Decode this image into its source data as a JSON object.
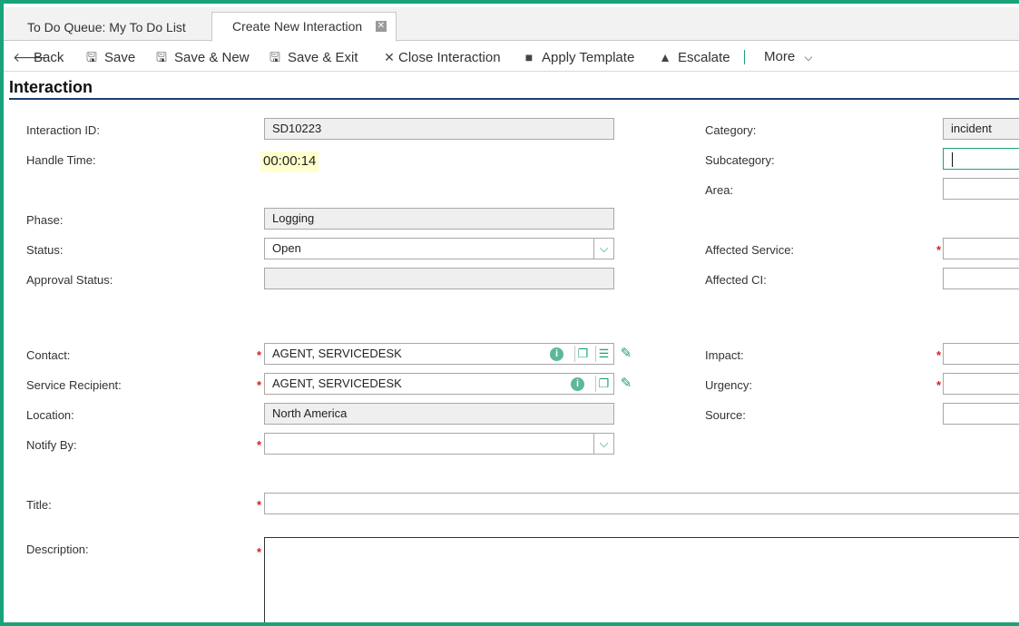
{
  "tabs": [
    {
      "label": "To Do Queue: My To Do List"
    },
    {
      "label": "Create New Interaction",
      "close_glyph": "✕"
    }
  ],
  "toolbar": {
    "back": "Back",
    "save": "Save",
    "save_new": "Save & New",
    "save_exit": "Save & Exit",
    "close_interaction": "Close Interaction",
    "apply_template": "Apply Template",
    "escalate": "Escalate",
    "more": "More"
  },
  "section": {
    "title": "Interaction"
  },
  "form": {
    "interaction_id": {
      "label": "Interaction ID:",
      "value": "SD10223"
    },
    "handle_time": {
      "label": "Handle Time:",
      "value": "00:00:14"
    },
    "phase": {
      "label": "Phase:",
      "value": "Logging"
    },
    "status": {
      "label": "Status:",
      "value": "Open"
    },
    "approval_status": {
      "label": "Approval Status:",
      "value": ""
    },
    "contact": {
      "label": "Contact:",
      "value": "AGENT, SERVICEDESK"
    },
    "service_recipient": {
      "label": "Service Recipient:",
      "value": "AGENT, SERVICEDESK"
    },
    "location": {
      "label": "Location:",
      "value": "North America"
    },
    "notify_by": {
      "label": "Notify By:",
      "value": ""
    },
    "category": {
      "label": "Category:",
      "value": "incident"
    },
    "subcategory": {
      "label": "Subcategory:",
      "value": ""
    },
    "area": {
      "label": "Area:",
      "value": ""
    },
    "affected_service": {
      "label": "Affected Service:",
      "value": ""
    },
    "affected_ci": {
      "label": "Affected CI:",
      "value": ""
    },
    "impact": {
      "label": "Impact:",
      "value": ""
    },
    "urgency": {
      "label": "Urgency:",
      "value": ""
    },
    "source": {
      "label": "Source:",
      "value": ""
    },
    "title": {
      "label": "Title:",
      "value": ""
    },
    "description": {
      "label": "Description:",
      "value": ""
    },
    "required_mark": "*"
  },
  "colors": {
    "accent": "#1aa37a",
    "required": "#d42020",
    "section_rule": "#1d3e6e"
  },
  "icons": [
    "back-arrow-icon",
    "save-icon",
    "save-new-icon",
    "save-exit-icon",
    "close-x-icon",
    "template-icon",
    "escalate-icon",
    "chevron-down-icon",
    "info-icon",
    "open-record-icon",
    "list-icon",
    "edit-link-icon"
  ]
}
